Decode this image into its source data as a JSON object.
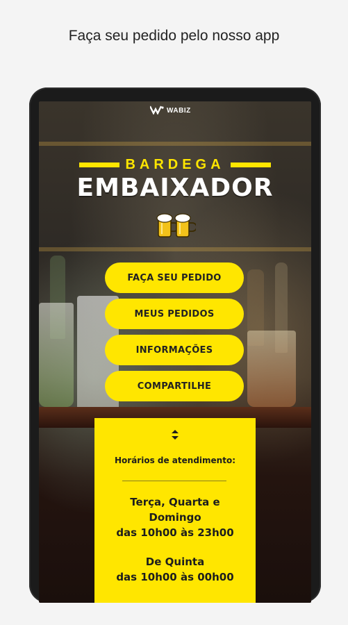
{
  "headline": "Faça seu pedido pelo nosso app",
  "brand": {
    "name": "WABIZ",
    "icon": "wabiz-logo-icon"
  },
  "logo": {
    "line1": "BARDEGA",
    "line2": "EMBAIXADOR",
    "icon": "beer-mugs-icon"
  },
  "menu": [
    {
      "label": "FAÇA SEU PEDIDO"
    },
    {
      "label": "MEUS PEDIDOS"
    },
    {
      "label": "INFORMAÇÕES"
    },
    {
      "label": "COMPARTILHE"
    }
  ],
  "hours": {
    "toggle_icon": "up-down-arrows-icon",
    "title": "Horários de atendimento:",
    "schedule": [
      {
        "days_line1": "Terça, Quarta e",
        "days_line2": "Domingo",
        "time": "das 10h00 às 23h00"
      },
      {
        "days_line1": "De Quinta",
        "time": "das 10h00 às 00h00"
      }
    ]
  },
  "colors": {
    "accent": "#ffe600",
    "device": "#1b1b1b",
    "page_background": "#f4f4f4"
  }
}
